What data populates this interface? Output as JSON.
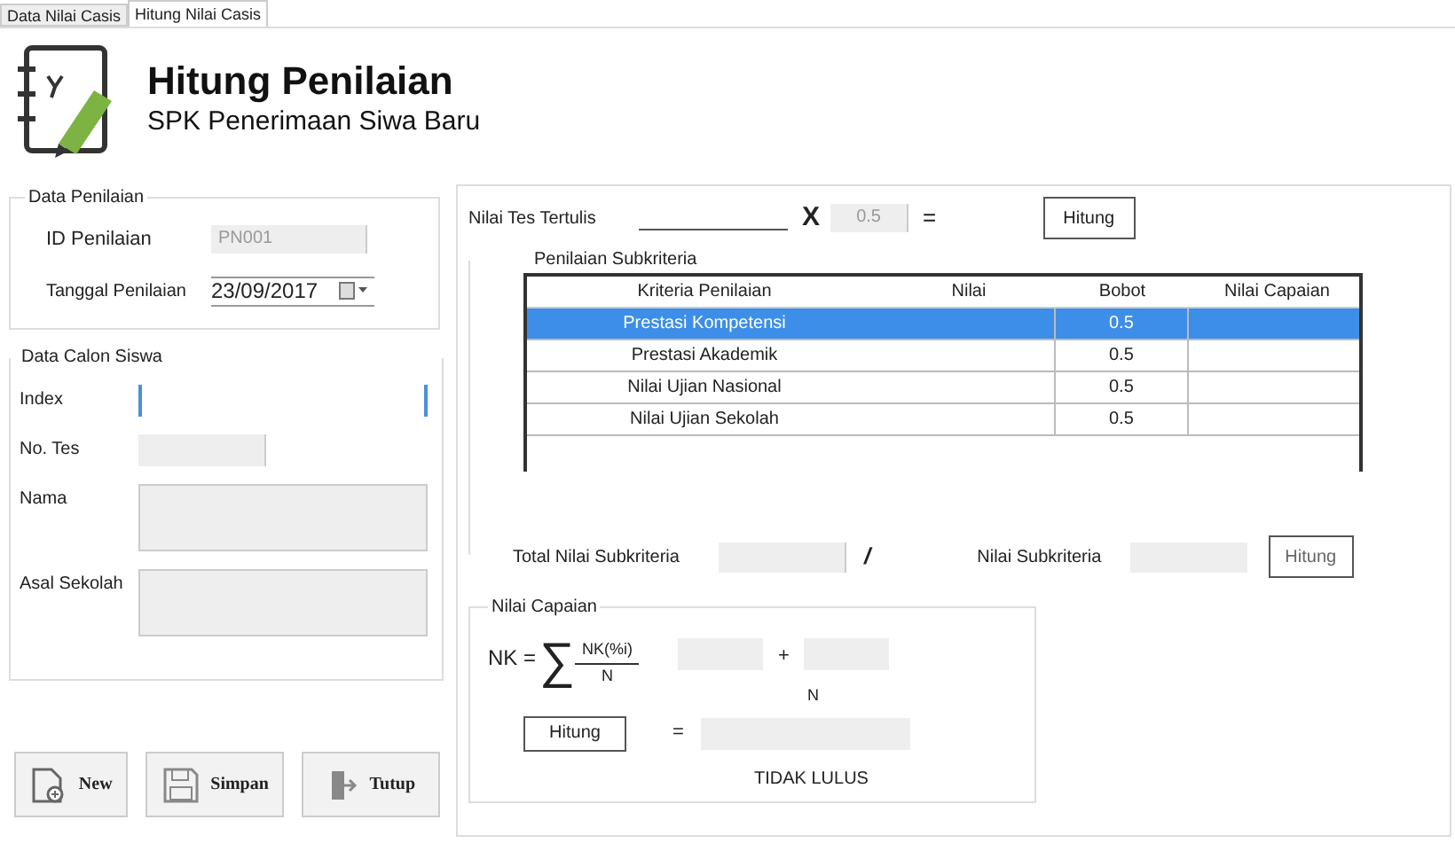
{
  "tabs": [
    {
      "label": "Data Nilai Casis",
      "selected": false
    },
    {
      "label": "Hitung Nilai Casis",
      "selected": true
    }
  ],
  "header": {
    "title": "Hitung Penilaian",
    "subtitle": "SPK Penerimaan Siwa Baru"
  },
  "data_penilaian": {
    "title": "Data Penilaian",
    "id_label": "ID Penilaian",
    "id_value": "PN001",
    "date_label": "Tanggal Penilaian",
    "date_value": "23/09/2017"
  },
  "data_calon_siswa": {
    "title": "Data Calon Siswa",
    "fields": [
      {
        "label": "Index",
        "kind": "focus"
      },
      {
        "label": "No. Tes",
        "kind": "short"
      },
      {
        "label": "Nama",
        "kind": "memo"
      },
      {
        "label": "Asal Sekolah",
        "kind": "memo"
      }
    ]
  },
  "buttons": [
    "New",
    "Simpan",
    "Tutup"
  ],
  "nilai_tes": {
    "label": "Nilai Tes Tertulis",
    "times": "X",
    "weight": "0.5",
    "equals": "=",
    "button": "Hitung"
  },
  "subkriteria": {
    "title": "Penilaian Subkriteria",
    "columns": [
      "Kriteria Penilaian",
      "Nilai",
      "Bobot",
      "Nilai Capaian"
    ],
    "rows": [
      {
        "kriteria": "Prestasi Kompetensi",
        "bobot": "0.5",
        "selected": true
      },
      {
        "kriteria": "Prestasi Akademik",
        "bobot": "0.5",
        "selected": false
      },
      {
        "kriteria": "Nilai Ujian Nasional",
        "bobot": "0.5",
        "selected": false
      },
      {
        "kriteria": "Nilai Ujian Sekolah",
        "bobot": "0.5",
        "selected": false
      }
    ],
    "total_label": "Total Nilai Subkriteria",
    "slash": "/",
    "nilai_label": "Nilai Subkriteria",
    "button": "Hitung"
  },
  "nilai_capaian": {
    "title": "Nilai Capaian",
    "nk": "NK =",
    "sigma": "∑",
    "numerator": "NK(%i)",
    "denominator": "N",
    "plus": "+",
    "n_below": "N",
    "button": "Hitung",
    "equals": "=",
    "result": "TIDAK LULUS"
  }
}
